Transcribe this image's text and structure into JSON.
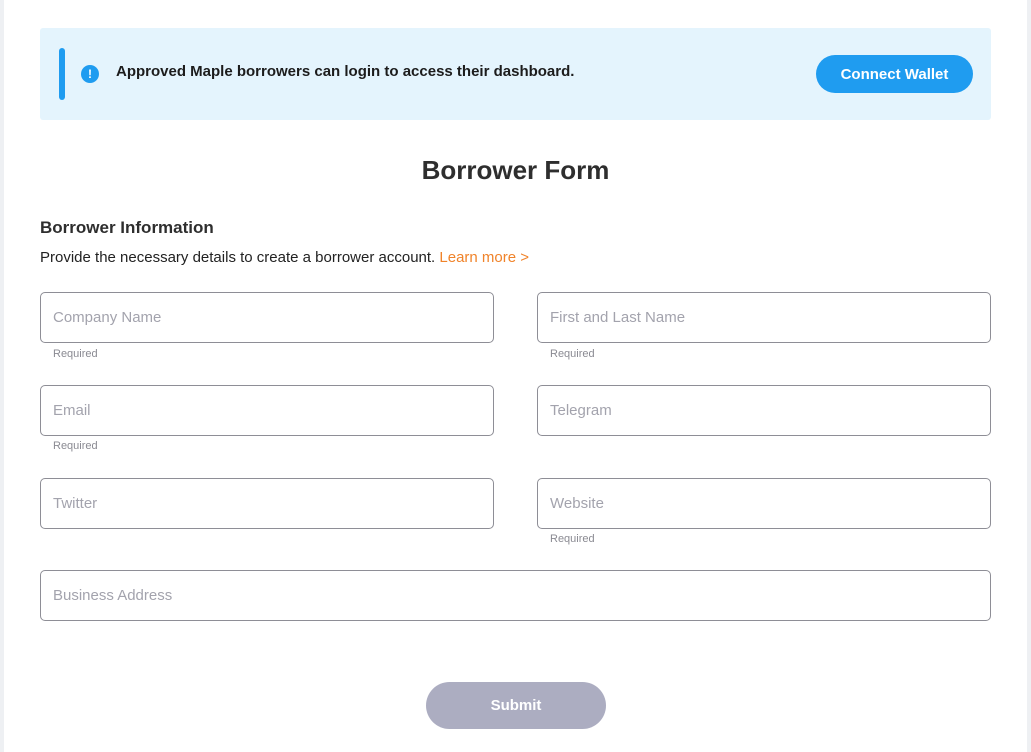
{
  "banner": {
    "message": "Approved Maple borrowers can login to access their dashboard.",
    "icon": "exclamation-circle-icon",
    "icon_glyph": "!",
    "button_label": "Connect Wallet"
  },
  "form": {
    "title": "Borrower Form",
    "section_heading": "Borrower Information",
    "description": "Provide the necessary details to create a borrower account.",
    "learn_more": "Learn more >",
    "fields": {
      "company_name": {
        "placeholder": "Company Name",
        "value": "",
        "helper": "Required"
      },
      "full_name": {
        "placeholder": "First and Last Name",
        "value": "",
        "helper": "Required"
      },
      "email": {
        "placeholder": "Email",
        "value": "",
        "helper": "Required"
      },
      "telegram": {
        "placeholder": "Telegram",
        "value": ""
      },
      "twitter": {
        "placeholder": "Twitter",
        "value": ""
      },
      "website": {
        "placeholder": "Website",
        "value": "",
        "helper": "Required"
      },
      "business_address": {
        "placeholder": "Business Address",
        "value": ""
      }
    },
    "submit_label": "Submit"
  },
  "colors": {
    "accent": "#1f9cf0",
    "link": "#f0832a",
    "banner_bg": "#e4f4fd",
    "submit_disabled": "#acadc1"
  }
}
